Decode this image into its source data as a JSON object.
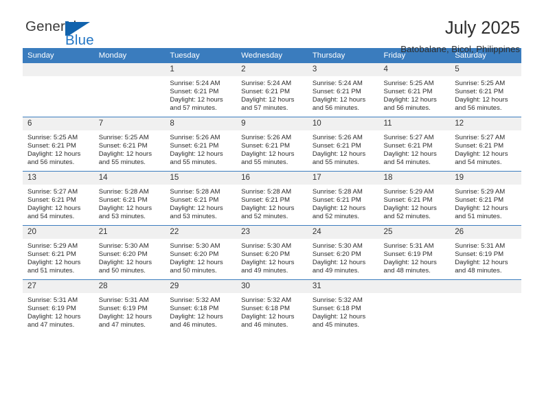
{
  "brand": {
    "name_dark": "General",
    "name_blue": "Blue",
    "accent_color": "#1263ad"
  },
  "header": {
    "title": "July 2025",
    "subtitle": "Batobalane, Bicol, Philippines",
    "header_bg_color": "#3a7cbe",
    "daynum_bg_color": "#f0f0f0"
  },
  "weekdays": [
    "Sunday",
    "Monday",
    "Tuesday",
    "Wednesday",
    "Thursday",
    "Friday",
    "Saturday"
  ],
  "labels": {
    "sunrise": "Sunrise:",
    "sunset": "Sunset:",
    "daylight": "Daylight:"
  },
  "weeks": [
    [
      {
        "day": "",
        "lines": []
      },
      {
        "day": "",
        "lines": []
      },
      {
        "day": "1",
        "lines": [
          "Sunrise: 5:24 AM",
          "Sunset: 6:21 PM",
          "Daylight: 12 hours",
          "and 57 minutes."
        ]
      },
      {
        "day": "2",
        "lines": [
          "Sunrise: 5:24 AM",
          "Sunset: 6:21 PM",
          "Daylight: 12 hours",
          "and 57 minutes."
        ]
      },
      {
        "day": "3",
        "lines": [
          "Sunrise: 5:24 AM",
          "Sunset: 6:21 PM",
          "Daylight: 12 hours",
          "and 56 minutes."
        ]
      },
      {
        "day": "4",
        "lines": [
          "Sunrise: 5:25 AM",
          "Sunset: 6:21 PM",
          "Daylight: 12 hours",
          "and 56 minutes."
        ]
      },
      {
        "day": "5",
        "lines": [
          "Sunrise: 5:25 AM",
          "Sunset: 6:21 PM",
          "Daylight: 12 hours",
          "and 56 minutes."
        ]
      }
    ],
    [
      {
        "day": "6",
        "lines": [
          "Sunrise: 5:25 AM",
          "Sunset: 6:21 PM",
          "Daylight: 12 hours",
          "and 56 minutes."
        ]
      },
      {
        "day": "7",
        "lines": [
          "Sunrise: 5:25 AM",
          "Sunset: 6:21 PM",
          "Daylight: 12 hours",
          "and 55 minutes."
        ]
      },
      {
        "day": "8",
        "lines": [
          "Sunrise: 5:26 AM",
          "Sunset: 6:21 PM",
          "Daylight: 12 hours",
          "and 55 minutes."
        ]
      },
      {
        "day": "9",
        "lines": [
          "Sunrise: 5:26 AM",
          "Sunset: 6:21 PM",
          "Daylight: 12 hours",
          "and 55 minutes."
        ]
      },
      {
        "day": "10",
        "lines": [
          "Sunrise: 5:26 AM",
          "Sunset: 6:21 PM",
          "Daylight: 12 hours",
          "and 55 minutes."
        ]
      },
      {
        "day": "11",
        "lines": [
          "Sunrise: 5:27 AM",
          "Sunset: 6:21 PM",
          "Daylight: 12 hours",
          "and 54 minutes."
        ]
      },
      {
        "day": "12",
        "lines": [
          "Sunrise: 5:27 AM",
          "Sunset: 6:21 PM",
          "Daylight: 12 hours",
          "and 54 minutes."
        ]
      }
    ],
    [
      {
        "day": "13",
        "lines": [
          "Sunrise: 5:27 AM",
          "Sunset: 6:21 PM",
          "Daylight: 12 hours",
          "and 54 minutes."
        ]
      },
      {
        "day": "14",
        "lines": [
          "Sunrise: 5:28 AM",
          "Sunset: 6:21 PM",
          "Daylight: 12 hours",
          "and 53 minutes."
        ]
      },
      {
        "day": "15",
        "lines": [
          "Sunrise: 5:28 AM",
          "Sunset: 6:21 PM",
          "Daylight: 12 hours",
          "and 53 minutes."
        ]
      },
      {
        "day": "16",
        "lines": [
          "Sunrise: 5:28 AM",
          "Sunset: 6:21 PM",
          "Daylight: 12 hours",
          "and 52 minutes."
        ]
      },
      {
        "day": "17",
        "lines": [
          "Sunrise: 5:28 AM",
          "Sunset: 6:21 PM",
          "Daylight: 12 hours",
          "and 52 minutes."
        ]
      },
      {
        "day": "18",
        "lines": [
          "Sunrise: 5:29 AM",
          "Sunset: 6:21 PM",
          "Daylight: 12 hours",
          "and 52 minutes."
        ]
      },
      {
        "day": "19",
        "lines": [
          "Sunrise: 5:29 AM",
          "Sunset: 6:21 PM",
          "Daylight: 12 hours",
          "and 51 minutes."
        ]
      }
    ],
    [
      {
        "day": "20",
        "lines": [
          "Sunrise: 5:29 AM",
          "Sunset: 6:21 PM",
          "Daylight: 12 hours",
          "and 51 minutes."
        ]
      },
      {
        "day": "21",
        "lines": [
          "Sunrise: 5:30 AM",
          "Sunset: 6:20 PM",
          "Daylight: 12 hours",
          "and 50 minutes."
        ]
      },
      {
        "day": "22",
        "lines": [
          "Sunrise: 5:30 AM",
          "Sunset: 6:20 PM",
          "Daylight: 12 hours",
          "and 50 minutes."
        ]
      },
      {
        "day": "23",
        "lines": [
          "Sunrise: 5:30 AM",
          "Sunset: 6:20 PM",
          "Daylight: 12 hours",
          "and 49 minutes."
        ]
      },
      {
        "day": "24",
        "lines": [
          "Sunrise: 5:30 AM",
          "Sunset: 6:20 PM",
          "Daylight: 12 hours",
          "and 49 minutes."
        ]
      },
      {
        "day": "25",
        "lines": [
          "Sunrise: 5:31 AM",
          "Sunset: 6:19 PM",
          "Daylight: 12 hours",
          "and 48 minutes."
        ]
      },
      {
        "day": "26",
        "lines": [
          "Sunrise: 5:31 AM",
          "Sunset: 6:19 PM",
          "Daylight: 12 hours",
          "and 48 minutes."
        ]
      }
    ],
    [
      {
        "day": "27",
        "lines": [
          "Sunrise: 5:31 AM",
          "Sunset: 6:19 PM",
          "Daylight: 12 hours",
          "and 47 minutes."
        ]
      },
      {
        "day": "28",
        "lines": [
          "Sunrise: 5:31 AM",
          "Sunset: 6:19 PM",
          "Daylight: 12 hours",
          "and 47 minutes."
        ]
      },
      {
        "day": "29",
        "lines": [
          "Sunrise: 5:32 AM",
          "Sunset: 6:18 PM",
          "Daylight: 12 hours",
          "and 46 minutes."
        ]
      },
      {
        "day": "30",
        "lines": [
          "Sunrise: 5:32 AM",
          "Sunset: 6:18 PM",
          "Daylight: 12 hours",
          "and 46 minutes."
        ]
      },
      {
        "day": "31",
        "lines": [
          "Sunrise: 5:32 AM",
          "Sunset: 6:18 PM",
          "Daylight: 12 hours",
          "and 45 minutes."
        ]
      },
      {
        "day": "",
        "lines": []
      },
      {
        "day": "",
        "lines": []
      }
    ]
  ]
}
